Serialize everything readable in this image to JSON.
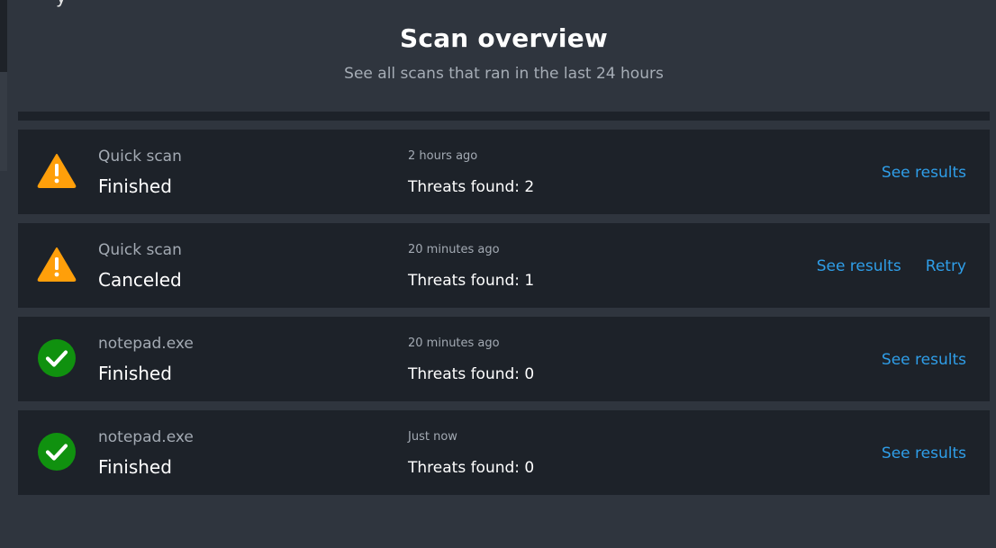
{
  "header": {
    "title": "Scan overview",
    "subtitle": "See all scans that ran in the last 24 hours"
  },
  "top_clip_text": "y",
  "colors": {
    "background": "#2f353e",
    "card": "#1d2229",
    "link": "#2f9ee8",
    "warning": "#ff9f0a",
    "success": "#10910f"
  },
  "scans": [
    {
      "name": "Quick scan",
      "state": "Finished",
      "time": "2 hours ago",
      "threats": "Threats found: 2",
      "status_icon": "warning-icon",
      "actions": [
        "See results"
      ]
    },
    {
      "name": "Quick scan",
      "state": "Canceled",
      "time": "20 minutes ago",
      "threats": "Threats found: 1",
      "status_icon": "warning-icon",
      "actions": [
        "See results",
        "Retry"
      ]
    },
    {
      "name": "notepad.exe",
      "state": "Finished",
      "time": "20 minutes ago",
      "threats": "Threats found: 0",
      "status_icon": "check-circle-icon",
      "actions": [
        "See results"
      ]
    },
    {
      "name": "notepad.exe",
      "state": "Finished",
      "time": "Just now",
      "threats": "Threats found: 0",
      "status_icon": "check-circle-icon",
      "actions": [
        "See results"
      ]
    }
  ]
}
